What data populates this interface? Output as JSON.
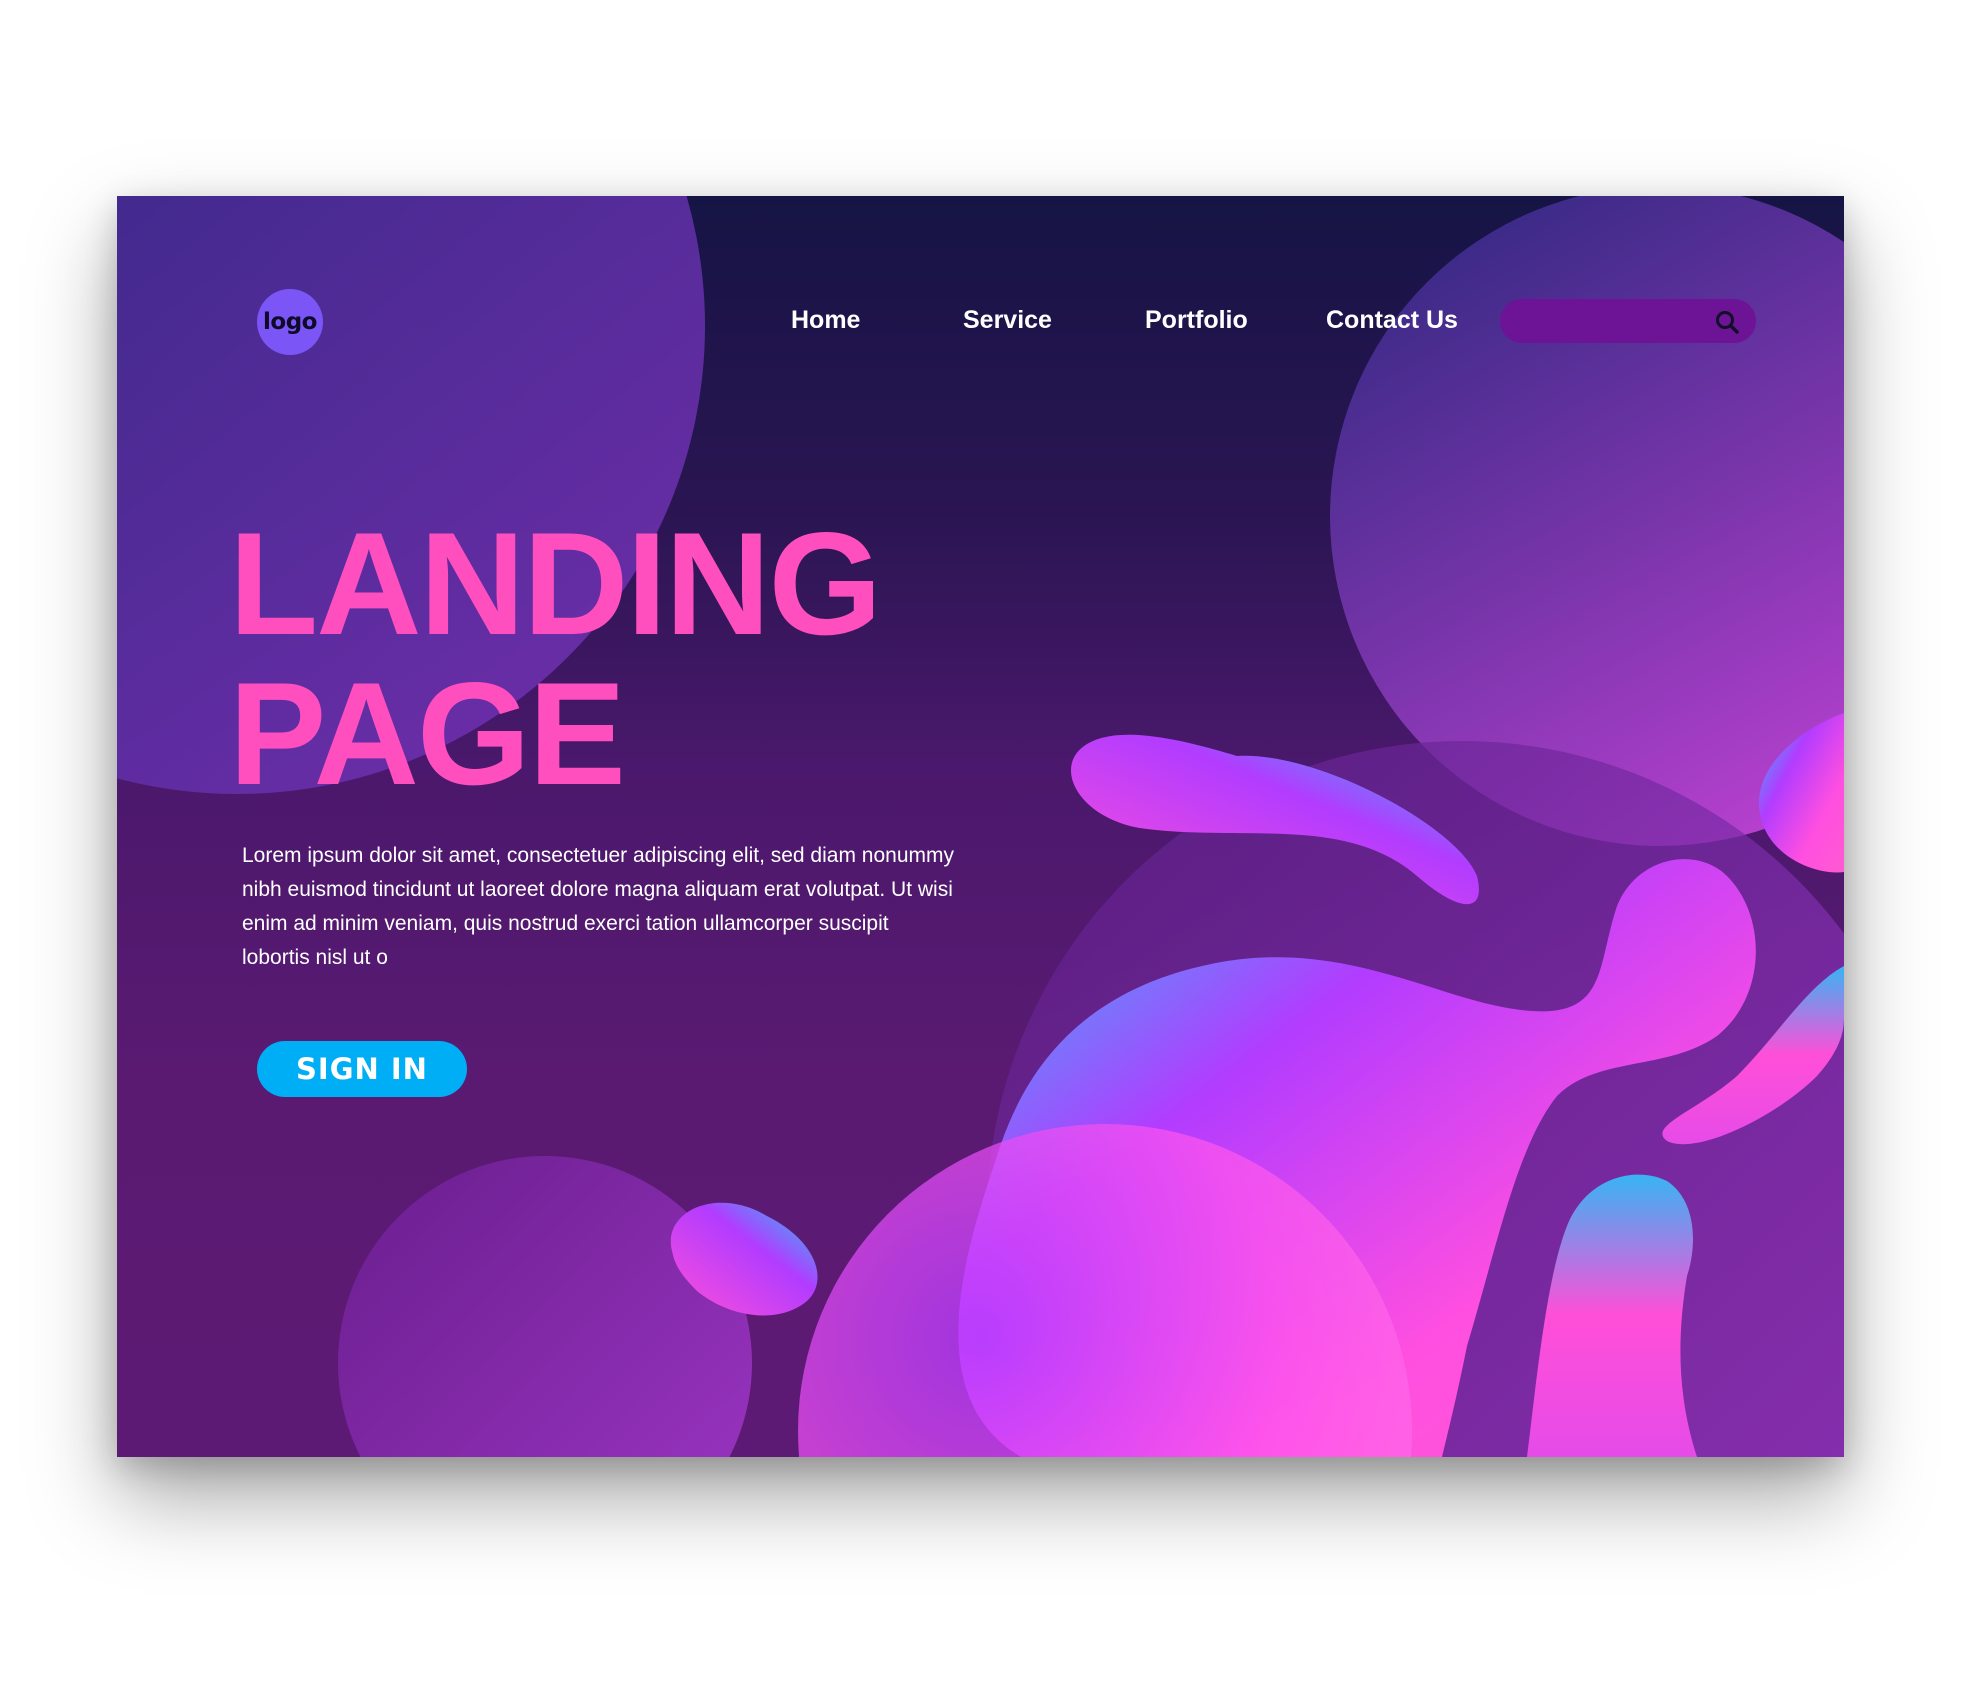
{
  "header": {
    "logo_text": "logo",
    "nav": [
      {
        "label": "Home"
      },
      {
        "label": "Service"
      },
      {
        "label": "Portfolio"
      },
      {
        "label": "Contact Us"
      }
    ],
    "search": {
      "value": "",
      "placeholder": "",
      "icon": "search-icon"
    }
  },
  "hero": {
    "title_line1": "LANDING",
    "title_line2": "PAGE",
    "body": "Lorem ipsum dolor sit amet, consectetuer adipiscing elit, sed diam nonummy nibh euismod tincidunt ut laoreet dolore magna aliquam erat volutpat. Ut wisi enim ad minim veniam, quis nostrud exerci tation ullamcorper suscipit lobortis nisl ut o",
    "cta_label": "SIGN IN"
  },
  "colors": {
    "title": "#ff4fbf",
    "cta": "#00aef5",
    "logo": "#7b55f5",
    "search_bg": "#6c1495",
    "blob_cyan": "#27c6f5",
    "blob_magenta": "#ff4fe0",
    "blob_violet": "#b23cff"
  }
}
